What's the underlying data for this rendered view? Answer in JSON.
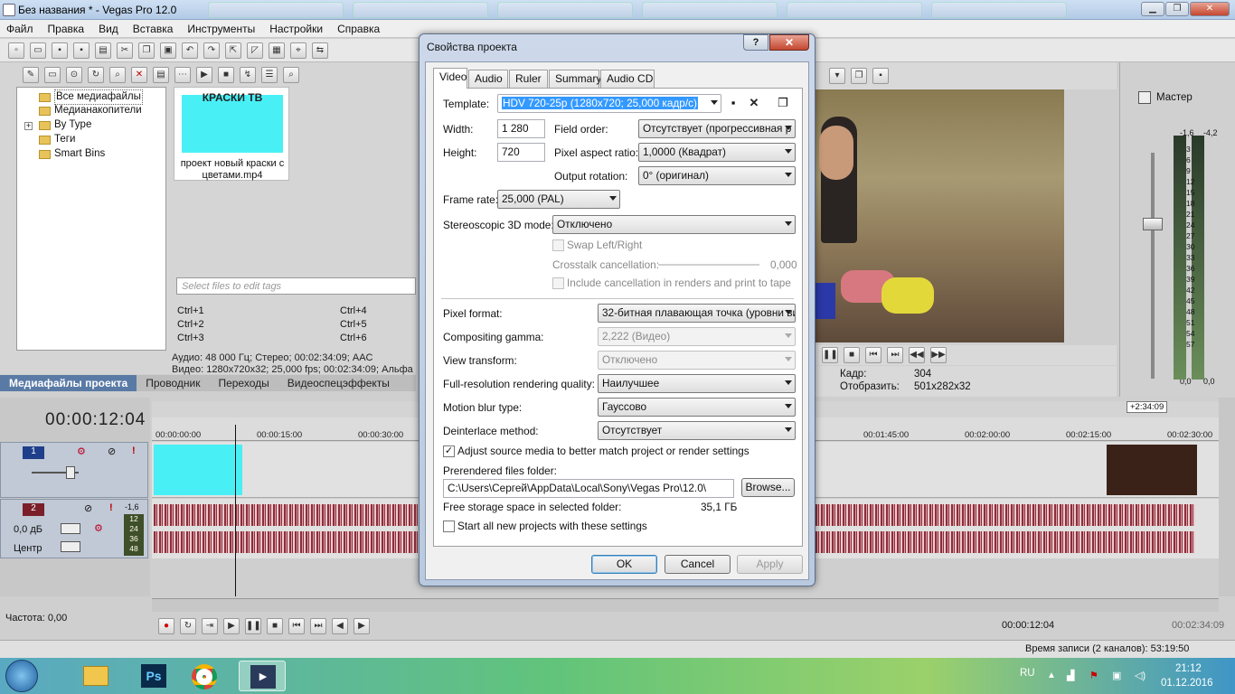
{
  "window": {
    "title": "Без названия * - Vegas Pro 12.0",
    "menu": [
      "Файл",
      "Правка",
      "Вид",
      "Вставка",
      "Инструменты",
      "Настройки",
      "Справка"
    ]
  },
  "explorer": {
    "tree": [
      "Все медиафайлы",
      "Медианакопители",
      "By Type",
      "Теги",
      "Smart Bins"
    ],
    "thumb_title": "КРАСКИ ТВ",
    "thumb_caption": "проект новый краски с цветами.mp4",
    "tag_placeholder": "Select files to edit tags",
    "shortcuts": [
      "Ctrl+1",
      "Ctrl+2",
      "Ctrl+3",
      "Ctrl+4",
      "Ctrl+5",
      "Ctrl+6"
    ],
    "media_info_audio": "Аудио: 48 000 Гц; Стерео; 00:02:34:09; AAC",
    "media_info_video": "Видео: 1280x720x32; 25,000 fps; 00:02:34:09; Альфа",
    "tabs": [
      "Медиафайлы проекта",
      "Проводник",
      "Переходы",
      "Видеоспецэффекты"
    ]
  },
  "preview": {
    "frame_label": "Кадр:",
    "frame_value": "304",
    "display_label": "Отобразить:",
    "display_value": "501x282x32"
  },
  "master": {
    "title": "Мастер",
    "peak_left": "-1,6",
    "peak_right": "-4,2",
    "scale": [
      "3",
      "6",
      "9",
      "12",
      "15",
      "18",
      "21",
      "24",
      "27",
      "30",
      "33",
      "36",
      "39",
      "42",
      "45",
      "48",
      "51",
      "54",
      "57"
    ],
    "bottom_left": "0,0",
    "bottom_right": "0,0"
  },
  "timeline": {
    "timecode": "00:00:12:04",
    "end_marker": "+2:34:09",
    "ruler": [
      "00:00:00:00",
      "00:00:15:00",
      "00:00:30:00",
      "00:01:45:00",
      "00:02:00:00",
      "00:02:15:00",
      "00:02:30:00"
    ],
    "track2_peak": "-1,6",
    "track2_volume": "0,0 дБ",
    "track2_pan": "Центр",
    "track2_scale": [
      "12",
      "24",
      "36",
      "48"
    ],
    "rate": "Частота: 0,00",
    "cursor_time": "00:00:12:04",
    "end_time": "00:02:34:09",
    "status": "Время записи (2 каналов): 53:19:50"
  },
  "taskbar": {
    "lang": "RU",
    "time": "21:12",
    "date": "01.12.2016"
  },
  "dialog": {
    "title": "Свойства проекта",
    "help": "?",
    "close": "✕",
    "tabs": [
      "Video",
      "Audio",
      "Ruler",
      "Summary",
      "Audio CD"
    ],
    "template_label": "Template:",
    "template_value": "HDV 720-25p (1280x720; 25,000 кадр/с)",
    "width_label": "Width:",
    "width_value": "1 280",
    "height_label": "Height:",
    "height_value": "720",
    "field_order_label": "Field order:",
    "field_order_value": "Отсутствует (прогрессивная р",
    "pixel_aspect_label": "Pixel aspect ratio:",
    "pixel_aspect_value": "1,0000 (Квадрат)",
    "output_rotation_label": "Output rotation:",
    "output_rotation_value": "0° (оригинал)",
    "frame_rate_label": "Frame rate:",
    "frame_rate_value": "25,000 (PAL)",
    "stereo_label": "Stereoscopic 3D mode:",
    "stereo_value": "Отключено",
    "swap_label": "Swap Left/Right",
    "crosstalk_label": "Crosstalk cancellation:",
    "crosstalk_value": "0,000",
    "include_cancel_label": "Include cancellation in renders and print to tape",
    "pixel_format_label": "Pixel format:",
    "pixel_format_value": "32-битная плавающая точка (уровни ви",
    "gamma_label": "Compositing gamma:",
    "gamma_value": "2,222 (Видео)",
    "view_transform_label": "View transform:",
    "view_transform_value": "Отключено",
    "quality_label": "Full-resolution rendering quality:",
    "quality_value": "Наилучшее",
    "motion_blur_label": "Motion blur type:",
    "motion_blur_value": "Гауссово",
    "deinterlace_label": "Deinterlace method:",
    "deinterlace_value": "Отсутствует",
    "adjust_label": "Adjust source media to better match project or render settings",
    "adjust_checked": true,
    "prerender_label": "Prerendered files folder:",
    "prerender_path": "C:\\Users\\Сергей\\AppData\\Local\\Sony\\Vegas Pro\\12.0\\",
    "browse_label": "Browse...",
    "free_space_label": "Free storage space in selected folder:",
    "free_space_value": "35,1 ГБ",
    "start_all_label": "Start all new projects with these settings",
    "ok": "OK",
    "cancel": "Cancel",
    "apply": "Apply"
  },
  "colors": {
    "accent": "#3c7fb1",
    "waveform": "#8b2e3a",
    "clip_cyan": "#48f0f6",
    "selection": "#3399ff"
  }
}
